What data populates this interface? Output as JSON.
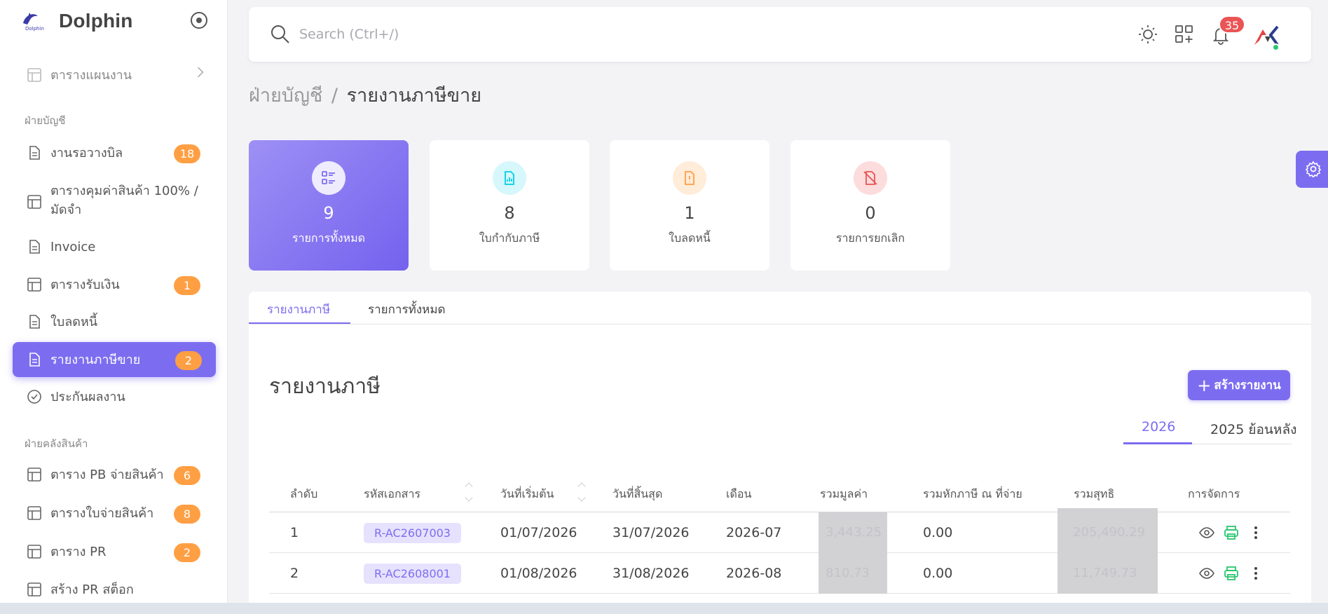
{
  "app": {
    "name": "Dolphin",
    "logo_text": "Dolphin"
  },
  "sidebar": {
    "top_items": [
      {
        "label": "ตารางแผนงาน"
      }
    ],
    "sections": [
      {
        "title": "ฝ่ายบัญชี"
      },
      {
        "title": "ฝ่ายคลังสินค้า"
      }
    ],
    "items": [
      {
        "label": "งานรอวางบิล",
        "badge": "18"
      },
      {
        "label": "ตารางคุมค่าสินค้า 100% / มัดจำ",
        "badge": ""
      },
      {
        "label": "Invoice",
        "badge": ""
      },
      {
        "label": "ตารางรับเงิน",
        "badge": "1"
      },
      {
        "label": "ใบลดหนี้",
        "badge": ""
      },
      {
        "label": "รายงานภาษีขาย",
        "badge": "2"
      },
      {
        "label": "ประกันผลงาน",
        "badge": ""
      },
      {
        "label": "ตาราง PB จ่ายสินค้า",
        "badge": "6"
      },
      {
        "label": "ตารางใบจ่ายสินค้า",
        "badge": "8"
      },
      {
        "label": "ตาราง PR",
        "badge": "2"
      },
      {
        "label": "สร้าง PR สต็อก",
        "badge": ""
      }
    ]
  },
  "topbar": {
    "search_placeholder": "Search (Ctrl+/)",
    "notification_count": "35",
    "colors": {
      "accent": "#7c6df0",
      "notif": "#ea5455",
      "online": "#28c76f"
    }
  },
  "breadcrumb": {
    "parent": "ฝ่ายบัญชี",
    "separator": "/",
    "current": "รายงานภาษีขาย"
  },
  "stats": [
    {
      "value": "9",
      "label": "รายการทั้งหมด",
      "icon": "list-icon"
    },
    {
      "value": "8",
      "label": "ใบกำกับภาษี",
      "icon": "invoice-chart-icon"
    },
    {
      "value": "1",
      "label": "ใบลดหนี้",
      "icon": "file-alert-icon"
    },
    {
      "value": "0",
      "label": "รายการยกเลิก",
      "icon": "file-cancel-icon"
    }
  ],
  "tabs": [
    {
      "label": "รายงานภาษี"
    },
    {
      "label": "รายการทั้งหมด"
    }
  ],
  "panel": {
    "title": "รายงานภาษี",
    "create_button": "สร้างรายงาน",
    "year_tabs": [
      {
        "label": "2026"
      },
      {
        "label": "2025 ย้อนหลัง"
      }
    ]
  },
  "table": {
    "columns": [
      "ลำดับ",
      "รหัสเอกสาร",
      "วันที่เริ่มต้น",
      "วันที่สิ้นสุด",
      "เดือน",
      "รวมมูลค่า",
      "รวมหักภาษี ณ ที่จ่าย",
      "รวมสุทธิ",
      "การจัดการ"
    ],
    "rows": [
      {
        "no": "1",
        "doc": "R-AC2607003",
        "start": "01/07/2026",
        "end": "31/07/2026",
        "month": "2026-07",
        "total": "3,443.25",
        "wht": "0.00",
        "net": "205,490.29"
      },
      {
        "no": "2",
        "doc": "R-AC2608001",
        "start": "01/08/2026",
        "end": "31/08/2026",
        "month": "2026-08",
        "total": "810.73",
        "wht": "0.00",
        "net": "11,749.73"
      }
    ]
  }
}
